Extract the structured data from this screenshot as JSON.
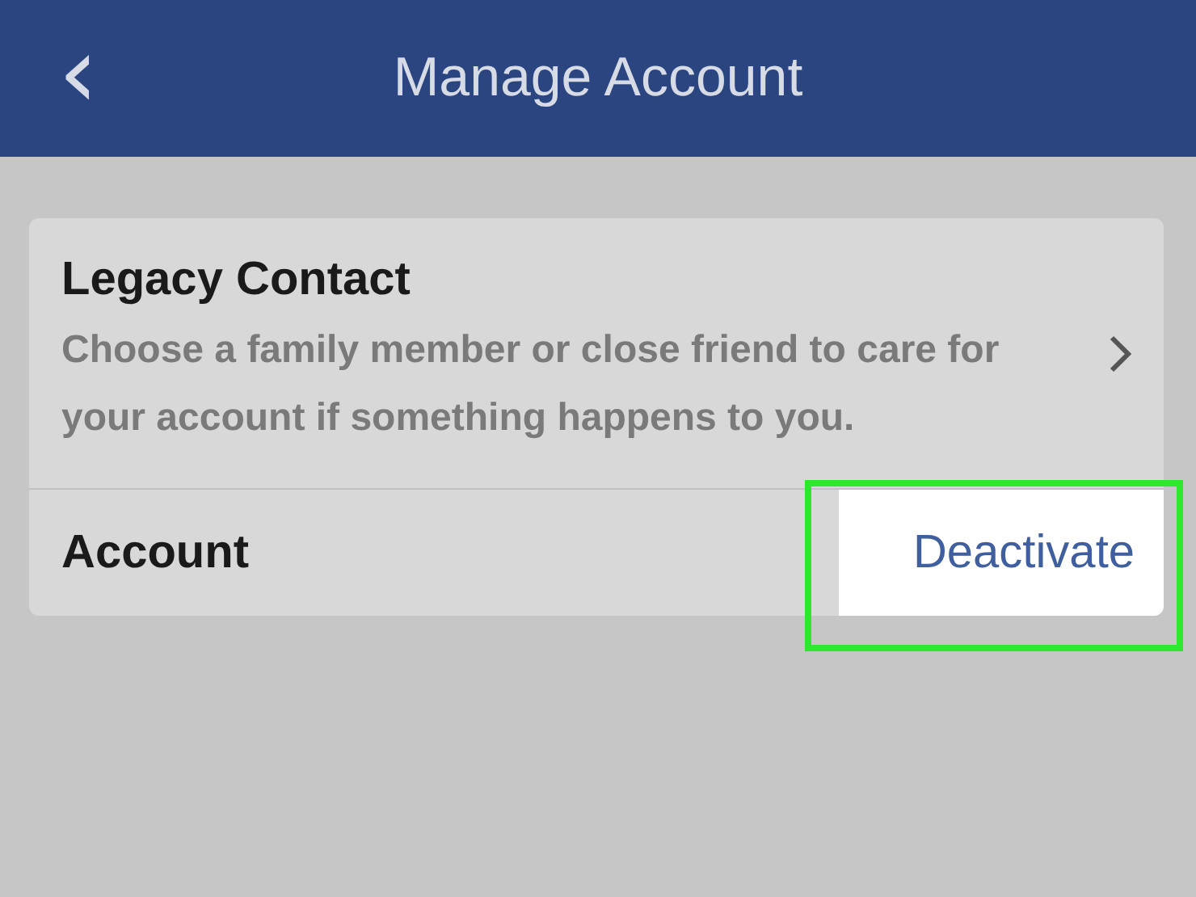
{
  "header": {
    "back_icon": "‹",
    "title": "Manage Account"
  },
  "legacy": {
    "title": "Legacy Contact",
    "description": "Choose a family member or close friend to care for your account if something happens to you."
  },
  "account": {
    "label": "Account",
    "action": "Deactivate",
    "highlighted": true
  }
}
